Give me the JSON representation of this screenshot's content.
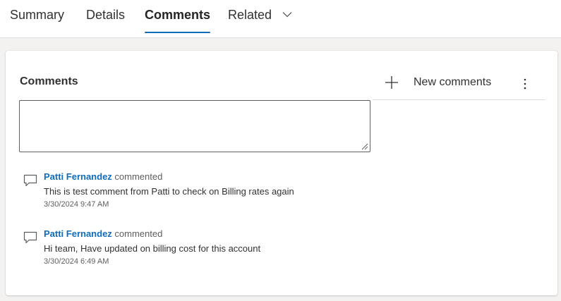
{
  "tabs": [
    {
      "label": "Summary"
    },
    {
      "label": "Details"
    },
    {
      "label": "Comments"
    },
    {
      "label": "Related"
    }
  ],
  "section": {
    "title": "Comments",
    "new_button_label": "New comments"
  },
  "comment_input": {
    "value": "",
    "placeholder": ""
  },
  "comments": [
    {
      "author": "Patti Fernandez",
      "action": "commented",
      "text": "This is test comment from Patti to check on Billing rates again",
      "timestamp": "3/30/2024 9:47 AM"
    },
    {
      "author": "Patti Fernandez",
      "action": "commented",
      "text": "Hi team, Have updated on billing cost for this account",
      "timestamp": "3/30/2024 6:49 AM"
    }
  ],
  "colors": {
    "accent": "#0f6cbd",
    "page_background": "#f3f2f1",
    "text": "#323130"
  },
  "icons": {
    "add": "plus-icon",
    "more": "more-vertical-icon",
    "comment": "comment-icon",
    "related_menu": "chevron-down-icon"
  }
}
